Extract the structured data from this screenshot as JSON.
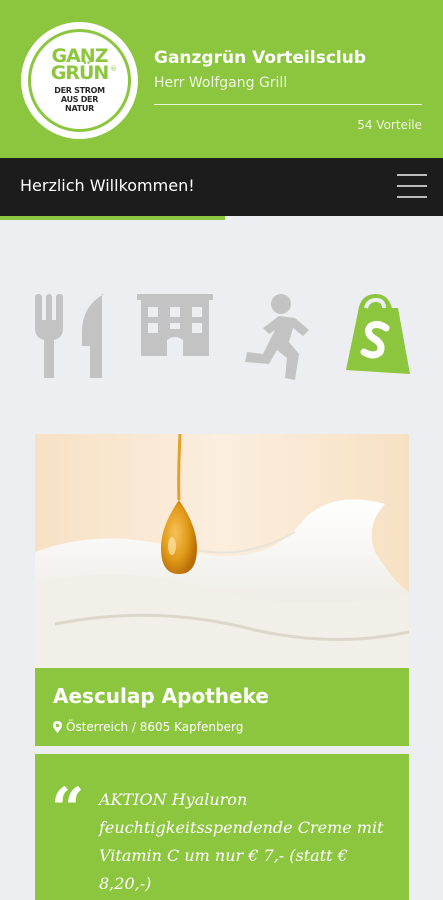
{
  "header": {
    "logo": {
      "line1": "GANZ",
      "line2": "GRÜN",
      "registered": "®",
      "tag1": "DER STROM",
      "tag2": "AUS DER",
      "tag3": "NATUR"
    },
    "title": "Ganzgrün Vorteilsclub",
    "member": "Herr Wolfgang Grill",
    "benefits": "54 Vorteile"
  },
  "navbar": {
    "welcome": "Herzlich Willkommen!",
    "menu_icon": "hamburger-icon"
  },
  "categories": [
    {
      "icon": "fork-knife-icon",
      "active": false
    },
    {
      "icon": "hotel-icon",
      "active": false
    },
    {
      "icon": "running-person-icon",
      "active": false
    },
    {
      "icon": "shopping-bag-icon",
      "active": true
    }
  ],
  "card": {
    "name": "Aesculap Apotheke",
    "location": "Österreich / 8605 Kapfenberg",
    "quote_mark": "“",
    "offer": "AKTION Hyaluron feuchtigkeitsspendende Creme mit Vitamin C um nur € 7,- (statt € 8,20,-)"
  },
  "colors": {
    "brand_green": "#8cc63f",
    "navbar": "#1c1c1c",
    "background": "#eceef1",
    "icon_inactive": "#c3c3c3"
  }
}
